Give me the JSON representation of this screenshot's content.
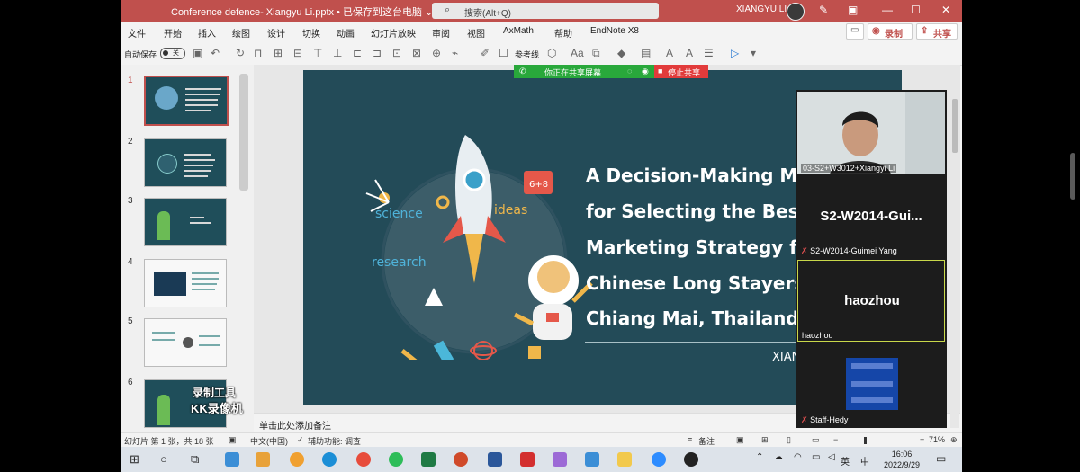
{
  "window": {
    "title": "Conference defence- Xiangyu Li.pptx • 已保存到这台电脑 ⌄",
    "search_placeholder": "搜索(Alt+Q)",
    "user": "XIANGYU LI",
    "brand_color": "#c0504d"
  },
  "menu": [
    "文件",
    "开始",
    "插入",
    "绘图",
    "设计",
    "切换",
    "动画",
    "幻灯片放映",
    "审阅",
    "视图",
    "AxMath",
    "帮助",
    "EndNote X8"
  ],
  "menu_right": {
    "record": "录制",
    "share": "共享"
  },
  "qat": {
    "autosave_label": "自动保存",
    "autosave_state": "关",
    "bullet_label": "参考线"
  },
  "thumbnails": [
    "1",
    "2",
    "3",
    "4",
    "5",
    "6"
  ],
  "watermark": {
    "line1": "录制工具",
    "line2": "KK录像机"
  },
  "sharing": {
    "status": "你正在共享屏幕",
    "stop": "停止共享"
  },
  "slide": {
    "title_lines": [
      "A Decision-Making M",
      "for Selecting the Best",
      "Marketing Strategy fo",
      "Chinese Long Stayers",
      "Chiang Mai, Thailand"
    ],
    "author_partial": "XIAN",
    "words": {
      "science": "science",
      "ideas": "ideas",
      "research": "research"
    },
    "background": "#234b58"
  },
  "notes_placeholder": "单击此处添加备注",
  "status": {
    "slide_info": "幻灯片 第 1 张，共 18 张",
    "language": "中文(中国)",
    "accessibility": "辅助功能: 调查",
    "notes": "备注",
    "zoom": "71%"
  },
  "participants": [
    {
      "name": "03-S2+W3012+Xiangyi Li",
      "big": ""
    },
    {
      "name": "S2-W2014-Guimei Yang",
      "big": "S2-W2014-Gui..."
    },
    {
      "name": "haozhou",
      "big": "haozhou"
    },
    {
      "name": "Staff-Hedy",
      "big": ""
    }
  ],
  "taskbar": {
    "time": "16:06",
    "date": "2022/9/29",
    "ime": "英",
    "input": "中"
  }
}
